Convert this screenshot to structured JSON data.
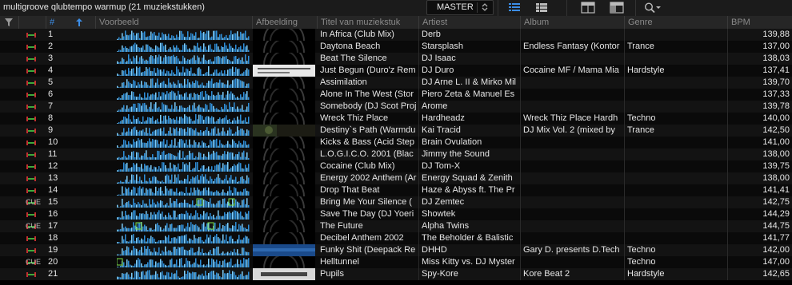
{
  "window": {
    "title": "multigroove qlubtempo warmup (21 muziekstukken)"
  },
  "toolbar": {
    "master_label": "MASTER",
    "icons": [
      "list-view-icon",
      "detail-list-icon",
      "browser-layout-icon",
      "split-layout-icon",
      "search-icon",
      "chevron-down-icon"
    ]
  },
  "table": {
    "columns": {
      "filter": "",
      "status": "",
      "number": "#",
      "preview": "Voorbeeld",
      "artwork": "Afbeelding",
      "title": "Titel van muziekstuk",
      "artist": "Artiest",
      "album": "Album",
      "genre": "Genre",
      "bpm": "BPM"
    },
    "sort_column": "number",
    "sort_direction": "ascending",
    "rows": [
      {
        "num": "1",
        "title": "In Africa (Club Mix)",
        "artist": "Derb",
        "album": "",
        "genre": "",
        "bpm": "139,88",
        "cue": "",
        "artwork": ""
      },
      {
        "num": "2",
        "title": "Daytona Beach",
        "artist": "Starsplash",
        "album": "Endless Fantasy (Kontor",
        "genre": "Trance",
        "bpm": "137,00",
        "cue": "",
        "artwork": ""
      },
      {
        "num": "3",
        "title": "Beat The Silence",
        "artist": "DJ Isaac",
        "album": "",
        "genre": "",
        "bpm": "138,03",
        "cue": "",
        "artwork": ""
      },
      {
        "num": "4",
        "title": "Just Begun (Duro'z Rem",
        "artist": "DJ Duro",
        "album": "Cocaine MF / Mama Mia",
        "genre": "Hardstyle",
        "bpm": "137,41",
        "cue": "",
        "artwork": "light"
      },
      {
        "num": "5",
        "title": " Assimilation",
        "artist": "DJ Arne L. II & Mirko Mil",
        "album": "",
        "genre": "",
        "bpm": "139,70",
        "cue": "",
        "artwork": ""
      },
      {
        "num": "6",
        "title": "Alone In The West (Stor",
        "artist": "Piero Zeta & Manuel Es",
        "album": "",
        "genre": "",
        "bpm": "137,33",
        "cue": "",
        "artwork": ""
      },
      {
        "num": "7",
        "title": "Somebody (DJ Scot Proj",
        "artist": "Arome",
        "album": "",
        "genre": "",
        "bpm": "139,78",
        "cue": "",
        "artwork": ""
      },
      {
        "num": "8",
        "title": "Wreck Thiz Place",
        "artist": "Hardheadz",
        "album": "Wreck Thiz Place  Hardh",
        "genre": "Techno",
        "bpm": "140,00",
        "cue": "",
        "artwork": ""
      },
      {
        "num": "9",
        "title": "Destiny`s Path (Warmdu",
        "artist": "Kai Tracid",
        "album": "DJ Mix Vol. 2 (mixed by",
        "genre": "Trance",
        "bpm": "142,50",
        "cue": "",
        "artwork": "dark"
      },
      {
        "num": "10",
        "title": "Kicks & Bass (Acid Step",
        "artist": "Brain Ovulation",
        "album": "",
        "genre": "",
        "bpm": "141,00",
        "cue": "",
        "artwork": ""
      },
      {
        "num": "11",
        "title": "L.O.G.I.C.O. 2001 (Blac",
        "artist": "Jimmy the Sound",
        "album": "",
        "genre": "",
        "bpm": "138,00",
        "cue": "",
        "artwork": ""
      },
      {
        "num": "12",
        "title": "Cocaine (Club Mix)",
        "artist": "DJ Tom-X",
        "album": "",
        "genre": "",
        "bpm": "139,75",
        "cue": "",
        "artwork": ""
      },
      {
        "num": "13",
        "title": "Energy 2002 Anthem (Ar",
        "artist": "Energy Squad & Zenith",
        "album": "",
        "genre": "",
        "bpm": "138,00",
        "cue": "",
        "artwork": ""
      },
      {
        "num": "14",
        "title": "Drop That Beat",
        "artist": "Haze & Abyss ft. The Pr",
        "album": "",
        "genre": "",
        "bpm": "141,41",
        "cue": "",
        "artwork": ""
      },
      {
        "num": "15",
        "title": "Bring Me Your Silence (",
        "artist": "DJ Zemtec",
        "album": "",
        "genre": "",
        "bpm": "142,75",
        "cue": "CUE",
        "artwork": ""
      },
      {
        "num": "16",
        "title": "Save The Day (DJ Yoeri",
        "artist": "Showtek",
        "album": "",
        "genre": "",
        "bpm": "144,29",
        "cue": "",
        "artwork": ""
      },
      {
        "num": "17",
        "title": "The Future",
        "artist": "Alpha Twins",
        "album": "",
        "genre": "",
        "bpm": "144,75",
        "cue": "CUE",
        "artwork": ""
      },
      {
        "num": "18",
        "title": "Decibel Anthem 2002",
        "artist": "The Beholder & Balistic",
        "album": "",
        "genre": "",
        "bpm": "141,77",
        "cue": "",
        "artwork": ""
      },
      {
        "num": "19",
        "title": "Funky Shit (Deepack Re",
        "artist": "DHHD",
        "album": "Gary D. presents D.Tech",
        "genre": "Techno",
        "bpm": "142,00",
        "cue": "",
        "artwork": "blue"
      },
      {
        "num": "20",
        "title": "Helltunnel",
        "artist": "Miss Kitty vs. DJ Myster",
        "album": "",
        "genre": "Techno",
        "bpm": "147,00",
        "cue": "CUE",
        "artwork": ""
      },
      {
        "num": "21",
        "title": "Pupils",
        "artist": "Spy-Kore",
        "album": "Kore Beat 2",
        "genre": "Hardstyle",
        "bpm": "142,65",
        "cue": "",
        "artwork": "light2"
      }
    ]
  },
  "colors": {
    "accent": "#3c8de6",
    "waveform": "#2f8fd8",
    "status_green": "#3ea83a",
    "status_red": "#c23030",
    "hot_cue": "#7ee04a"
  }
}
